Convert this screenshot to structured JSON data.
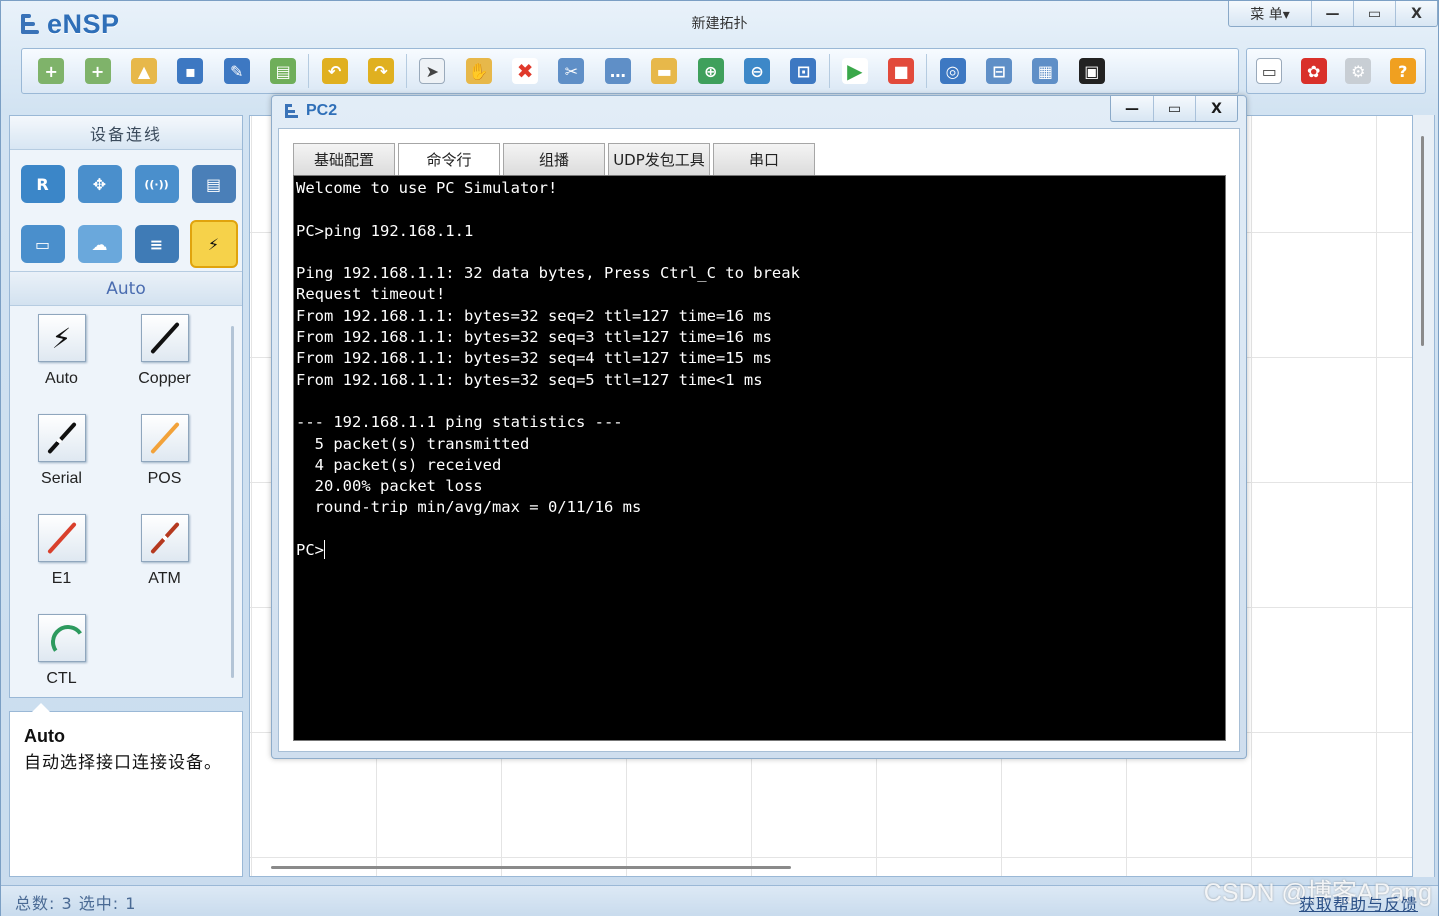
{
  "app": {
    "logo_text": "eNSP",
    "title": "新建拓扑",
    "menu_label": "菜 单▾",
    "minimize": "—",
    "maximize": "▭",
    "close": "X"
  },
  "toolbar": {
    "icons": [
      "new-topology-icon",
      "new-example-icon",
      "open-icon",
      "save-icon",
      "save-as-icon",
      "print-icon",
      "undo-icon",
      "redo-icon",
      "select-pointer-icon",
      "pan-hand-icon",
      "delete-icon",
      "delete-link-icon",
      "text-note-icon",
      "rectangle-icon",
      "zoom-in-icon",
      "zoom-out-icon",
      "fit-window-icon",
      "start-device-icon",
      "stop-device-icon",
      "capture-icon",
      "topology-icon",
      "grid-icon",
      "cli-icon"
    ],
    "right_icons": [
      "chat-icon",
      "huawei-icon",
      "settings-gear-icon",
      "help-icon"
    ]
  },
  "left_panel": {
    "header": "设备连线",
    "categories": [
      {
        "name": "router-icon",
        "glyph": "R",
        "color": "#3b86c8"
      },
      {
        "name": "switch-icon",
        "glyph": "✥",
        "color": "#4a8fcc"
      },
      {
        "name": "wireless-ap-icon",
        "glyph": "((·))",
        "color": "#4a8fcc"
      },
      {
        "name": "firewall-icon",
        "glyph": "▤",
        "color": "#4a7fb8"
      },
      {
        "name": "pc-terminal-icon",
        "glyph": "▭",
        "color": "#4a8fcc"
      },
      {
        "name": "cloud-icon",
        "glyph": "☁",
        "color": "#6aa8dc"
      },
      {
        "name": "other-device-icon",
        "glyph": "≡",
        "color": "#3f7bb6"
      },
      {
        "name": "link-cable-icon",
        "glyph": "⚡",
        "color": "#f6d24a"
      }
    ],
    "sub_header": "Auto",
    "cables": [
      {
        "label": "Auto",
        "color": "#111111",
        "icon": "auto-cable-icon"
      },
      {
        "label": "Copper",
        "color": "#111111",
        "icon": "copper-cable-icon"
      },
      {
        "label": "Serial",
        "color": "#111111",
        "icon": "serial-cable-icon"
      },
      {
        "label": "POS",
        "color": "#f2a23a",
        "icon": "pos-cable-icon"
      },
      {
        "label": "E1",
        "color": "#d9402c",
        "icon": "e1-cable-icon"
      },
      {
        "label": "ATM",
        "color": "#b5391f",
        "icon": "atm-cable-icon"
      },
      {
        "label": "CTL",
        "color": "#2d9a5e",
        "icon": "ctl-cable-icon"
      }
    ]
  },
  "description": {
    "title": "Auto",
    "text": "自动选择接口连接设备。"
  },
  "dialog": {
    "title": "PC2",
    "minimize": "—",
    "maximize": "▭",
    "close": "X",
    "tabs": [
      "基础配置",
      "命令行",
      "组播",
      "UDP发包工具",
      "串口"
    ],
    "active_tab": 1,
    "terminal_lines": [
      "Welcome to use PC Simulator!",
      "",
      "PC>ping 192.168.1.1",
      "",
      "Ping 192.168.1.1: 32 data bytes, Press Ctrl_C to break",
      "Request timeout!",
      "From 192.168.1.1: bytes=32 seq=2 ttl=127 time=16 ms",
      "From 192.168.1.1: bytes=32 seq=3 ttl=127 time=16 ms",
      "From 192.168.1.1: bytes=32 seq=4 ttl=127 time=15 ms",
      "From 192.168.1.1: bytes=32 seq=5 ttl=127 time<1 ms",
      "",
      "--- 192.168.1.1 ping statistics ---",
      "  5 packet(s) transmitted",
      "  4 packet(s) received",
      "  20.00% packet loss",
      "  round-trip min/avg/max = 0/11/16 ms",
      ""
    ],
    "prompt": "PC>"
  },
  "status": {
    "text": "总数: 3  选中: 1",
    "help_link": "获取帮助与反馈",
    "watermark": "CSDN @博客APang"
  }
}
